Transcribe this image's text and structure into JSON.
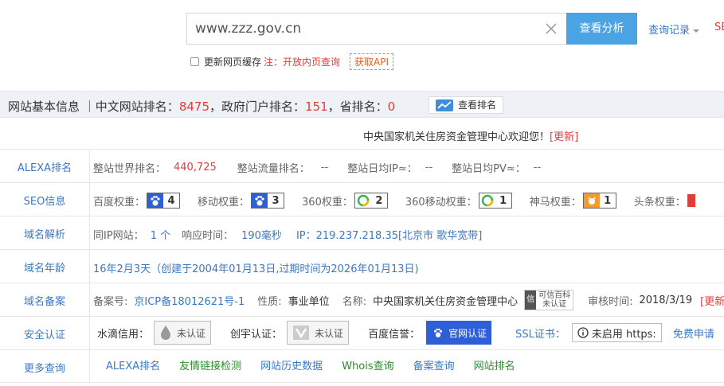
{
  "search": {
    "value": "www.zzz.gov.cn",
    "analyze_label": "查看分析",
    "history_label": "查询记录",
    "cut_link": "SE"
  },
  "cache": {
    "label": "更新网页缓存",
    "note": "注：开放内页查询",
    "api_label": "获取API"
  },
  "info_bar": {
    "title": "网站基本信息",
    "cn_rank_label": "｜中文网站排名：",
    "cn_rank": "8475",
    "gov_rank_label": "，政府门户排名：",
    "gov_rank": "151",
    "prov_rank_label": "，省排名：",
    "prov_rank": "0",
    "rank_button": "查看排名"
  },
  "welcome": {
    "text": "中央国家机关住房资金管理中心欢迎您！",
    "update": "[更新]"
  },
  "alexa": {
    "label": "ALEXA排名",
    "world_label": "整站世界排名：",
    "world_value": "440,725",
    "traffic_label": "整站流量排名：",
    "traffic_value": "--",
    "ip_label": "整站日均IP≈：",
    "ip_value": "--",
    "pv_label": "整站日均PV≈：",
    "pv_value": "--"
  },
  "seo": {
    "label": "SEO信息",
    "baidu_label": "百度权重：",
    "baidu_value": "4",
    "mobile_label": "移动权重：",
    "mobile_value": "3",
    "s360_label": "360权重：",
    "s360_value": "2",
    "s360m_label": "360移动权重：",
    "s360m_value": "1",
    "shenma_label": "神马权重：",
    "shenma_value": "1",
    "toutiao_label": "头条权重："
  },
  "domain": {
    "label": "域名解析",
    "sameip_label": "同IP网站：",
    "sameip_value": "1 个",
    "resp_label": "响应时间：",
    "resp_value": "190毫秒",
    "ip_text": "IP：219.237.218.35[北京市 歌华宽带]"
  },
  "age": {
    "label": "域名年龄",
    "text": "16年2月3天（创建于2004年01月13日,过期时间为2026年01月13日)"
  },
  "beian": {
    "label": "域名备案",
    "no_label": "备案号:",
    "no_value": "京ICP备18012621号-1",
    "type_label": "性质:",
    "type_value": "事业单位",
    "name_label": "名称:",
    "name_value": "中央国家机关住房资金管理中心",
    "credible_line1": "可信百科",
    "credible_line2": "未认证",
    "credible_char": "信",
    "audit_label": "审核时间:",
    "audit_value": "2018/3/19",
    "update": "[更新"
  },
  "security": {
    "label": "安全认证",
    "shuidi_label": "水滴信用：",
    "shuidi_value": "未认证",
    "chuangyu_label": "创宇认证：",
    "chuangyu_value": "未认证",
    "baidu_label": "百度信誉：",
    "baidu_value": "官网认证",
    "ssl_label": "SSL证书：",
    "ssl_value": "未启用 https:",
    "free_label": "免费申请"
  },
  "more": {
    "label": "更多查询",
    "links": [
      "ALEXA排名",
      "友情链接检测",
      "网站历史数据",
      "Whois查询",
      "备案查询",
      "网站排名"
    ]
  },
  "colors": {
    "accent": "#4aa3e3",
    "link": "#3a78c3",
    "red": "#e53b3b",
    "green": "#2e8b2e"
  }
}
